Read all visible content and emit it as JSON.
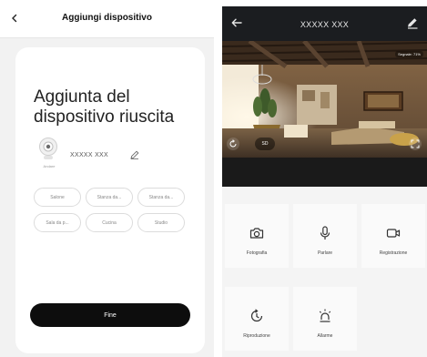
{
  "left": {
    "header_title": "Aggiungi dispositivo",
    "success_title": "Aggiunta del dispositivo riuscita",
    "device": {
      "name": "XXXXX XXX",
      "subtitle": "Andare"
    },
    "room_chips": [
      "Salone",
      "Stanza da...",
      "Stanza da...",
      "Sala da p...",
      "Cucina",
      "Studio"
    ],
    "finish_label": "Fine",
    "accent": "#0d0d0d"
  },
  "right": {
    "header_title": "XXXXX XXX",
    "signal_badge": "Segnale: 71%",
    "quality_label": "SD",
    "controls": [
      {
        "label": "Fotografia",
        "icon": "camera-icon"
      },
      {
        "label": "Parlare",
        "icon": "microphone-icon"
      },
      {
        "label": "Registrazione",
        "icon": "video-record-icon"
      },
      {
        "label": "Riproduzione",
        "icon": "playback-icon"
      },
      {
        "label": "Allarme",
        "icon": "alarm-light-icon"
      }
    ],
    "header_bg": "#1b1d20"
  }
}
